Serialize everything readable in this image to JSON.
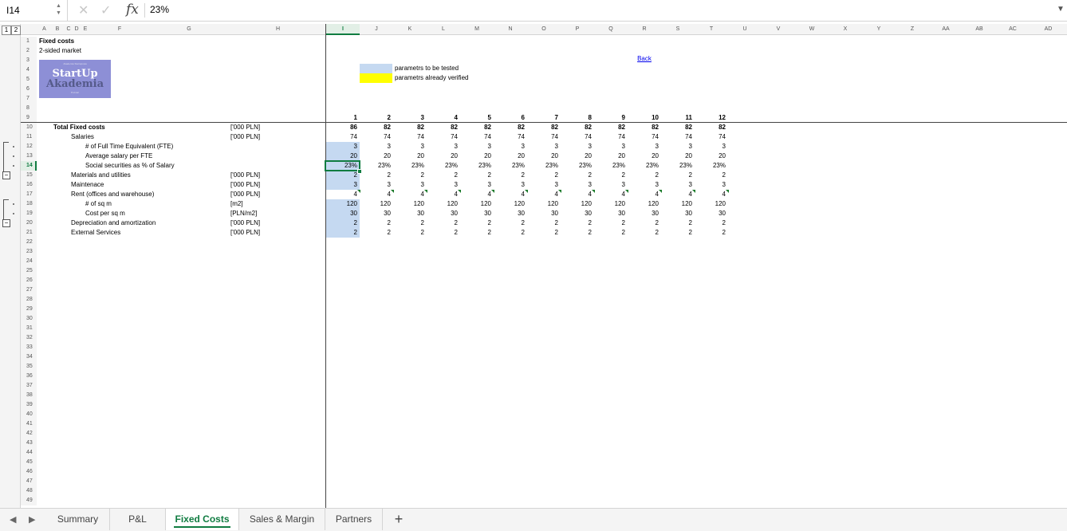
{
  "formula_bar": {
    "name_box": "I14",
    "fx": "fx",
    "value": "23%"
  },
  "outline_levels": [
    "1",
    "2"
  ],
  "columns": [
    "A",
    "B",
    "C",
    "D",
    "E",
    "F",
    "G",
    "H",
    "I",
    "J",
    "K",
    "L",
    "M",
    "N",
    "O",
    "P",
    "Q",
    "R",
    "S",
    "T",
    "U",
    "V",
    "W",
    "X",
    "Y",
    "Z",
    "AA",
    "AB",
    "AC",
    "AD"
  ],
  "selected_column": "I",
  "rows": [
    "1",
    "2",
    "3",
    "4",
    "5",
    "6",
    "7",
    "8",
    "9",
    "10",
    "11",
    "12",
    "13",
    "14",
    "15",
    "16",
    "17",
    "18",
    "19",
    "20",
    "21",
    "22",
    "23",
    "24",
    "25",
    "26",
    "27",
    "28",
    "29",
    "30",
    "31",
    "32",
    "33",
    "34",
    "35",
    "36",
    "37",
    "38",
    "39",
    "40",
    "41",
    "42",
    "43",
    "44",
    "45",
    "46",
    "47",
    "48",
    "49"
  ],
  "selected_row": "14",
  "sheet_title": "Fixed costs",
  "sheet_subtitle": "2-sided market",
  "logo": {
    "top_text": "Akademia Startupowa",
    "line1": "StartUp",
    "line2": "Akademia",
    "bottom_text": "Poznań"
  },
  "legend": {
    "tested_label": "parametrs to be tested",
    "verified_label": "parametrs already verified",
    "tested_color": "#c5d9f1",
    "verified_color": "#ffff00"
  },
  "back_link": "Back",
  "period_headers": [
    "1",
    "2",
    "3",
    "4",
    "5",
    "6",
    "7",
    "8",
    "9",
    "10",
    "11",
    "12"
  ],
  "table_rows": [
    {
      "row": "10",
      "label": "Total Fixed costs",
      "indent": 0,
      "bold": true,
      "unit": "['000 PLN]",
      "values": [
        "86",
        "82",
        "82",
        "82",
        "82",
        "82",
        "82",
        "82",
        "82",
        "82",
        "82",
        "82"
      ]
    },
    {
      "row": "11",
      "label": "Salaries",
      "indent": 1,
      "bold": false,
      "unit": "['000 PLN]",
      "values": [
        "74",
        "74",
        "74",
        "74",
        "74",
        "74",
        "74",
        "74",
        "74",
        "74",
        "74",
        "74"
      ]
    },
    {
      "row": "12",
      "label": "# of Full Time Equivalent (FTE)",
      "indent": 2,
      "bold": false,
      "unit": "",
      "values": [
        "3",
        "3",
        "3",
        "3",
        "3",
        "3",
        "3",
        "3",
        "3",
        "3",
        "3",
        "3"
      ],
      "first_tested": true
    },
    {
      "row": "13",
      "label": "Average salary per FTE",
      "indent": 2,
      "bold": false,
      "unit": "",
      "values": [
        "20",
        "20",
        "20",
        "20",
        "20",
        "20",
        "20",
        "20",
        "20",
        "20",
        "20",
        "20"
      ],
      "first_tested": true
    },
    {
      "row": "14",
      "label": "Social securities as % of Salary",
      "indent": 2,
      "bold": false,
      "unit": "",
      "values": [
        "23%",
        "23%",
        "23%",
        "23%",
        "23%",
        "23%",
        "23%",
        "23%",
        "23%",
        "23%",
        "23%",
        "23%"
      ],
      "first_tested": true
    },
    {
      "row": "15",
      "label": "Materials and utilities",
      "indent": 1,
      "bold": false,
      "unit": "['000 PLN]",
      "values": [
        "2",
        "2",
        "2",
        "2",
        "2",
        "2",
        "2",
        "2",
        "2",
        "2",
        "2",
        "2"
      ],
      "first_tested": true
    },
    {
      "row": "16",
      "label": "Maintenace",
      "indent": 1,
      "bold": false,
      "unit": "['000 PLN]",
      "values": [
        "3",
        "3",
        "3",
        "3",
        "3",
        "3",
        "3",
        "3",
        "3",
        "3",
        "3",
        "3"
      ],
      "first_tested": true
    },
    {
      "row": "17",
      "label": "Rent (offices and warehouse)",
      "indent": 1,
      "bold": false,
      "unit": "['000 PLN]",
      "values": [
        "4",
        "4",
        "4",
        "4",
        "4",
        "4",
        "4",
        "4",
        "4",
        "4",
        "4",
        "4"
      ],
      "flagged": true
    },
    {
      "row": "18",
      "label": "# of sq m",
      "indent": 2,
      "bold": false,
      "unit": "[m2]",
      "values": [
        "120",
        "120",
        "120",
        "120",
        "120",
        "120",
        "120",
        "120",
        "120",
        "120",
        "120",
        "120"
      ],
      "first_tested": true
    },
    {
      "row": "19",
      "label": "Cost per sq m",
      "indent": 2,
      "bold": false,
      "unit": "[PLN/m2]",
      "values": [
        "30",
        "30",
        "30",
        "30",
        "30",
        "30",
        "30",
        "30",
        "30",
        "30",
        "30",
        "30"
      ],
      "first_tested": true
    },
    {
      "row": "20",
      "label": "Depreciation and amortization",
      "indent": 1,
      "bold": false,
      "unit": "['000 PLN]",
      "values": [
        "2",
        "2",
        "2",
        "2",
        "2",
        "2",
        "2",
        "2",
        "2",
        "2",
        "2",
        "2"
      ],
      "first_tested": true
    },
    {
      "row": "21",
      "label": "External Services",
      "indent": 1,
      "bold": false,
      "unit": "['000 PLN]",
      "values": [
        "2",
        "2",
        "2",
        "2",
        "2",
        "2",
        "2",
        "2",
        "2",
        "2",
        "2",
        "2"
      ],
      "first_tested": true
    }
  ],
  "sheet_tabs": [
    "Summary",
    "P&L",
    "Fixed Costs",
    "Sales & Margin",
    "Partners"
  ],
  "active_tab": "Fixed Costs",
  "add_sheet": "+"
}
